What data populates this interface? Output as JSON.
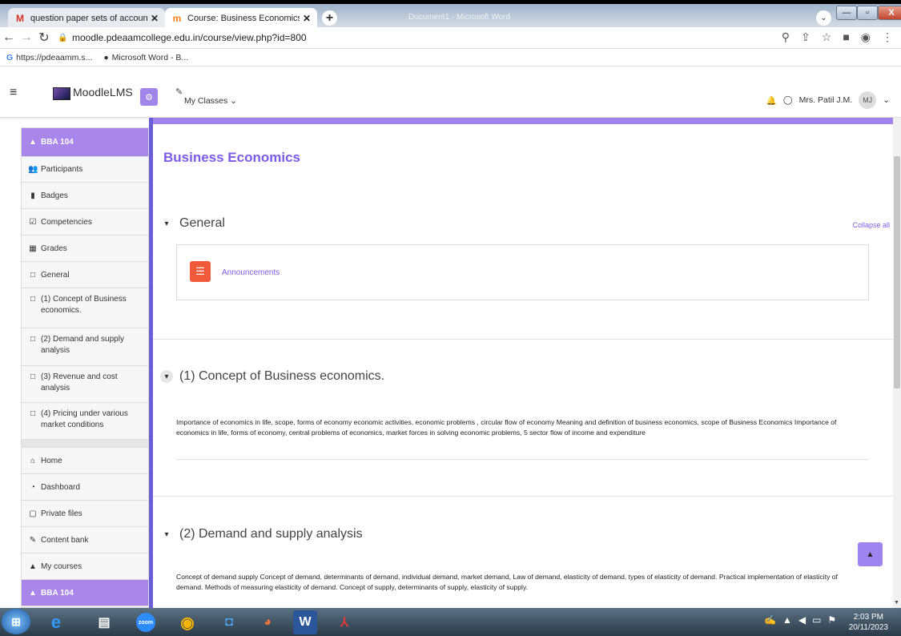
{
  "browser": {
    "tabs": [
      {
        "title": "question paper sets of accountin",
        "icon": "gmail-icon"
      },
      {
        "title": "Course: Business Economics",
        "icon": "moodle-icon"
      }
    ],
    "background_window_title": "Document1 - Microsoft Word",
    "url": "moodle.pdeaamcollege.edu.in/course/view.php?id=800",
    "bookmarks": [
      "https://pdeaamm.s...",
      "Microsoft Word - B..."
    ]
  },
  "navbar": {
    "brand": "MoodleLMS",
    "my_classes": "My Classes ⌄",
    "user_name": "Mrs. Patil J.M.",
    "avatar_initials": "MJ"
  },
  "sidebar": {
    "course": "BBA 104",
    "items": [
      {
        "label": "Participants",
        "icon": "👥"
      },
      {
        "label": "Badges",
        "icon": "▮"
      },
      {
        "label": "Competencies",
        "icon": "☑"
      },
      {
        "label": "Grades",
        "icon": "▦"
      },
      {
        "label": "General",
        "icon": "□"
      },
      {
        "label": "(1) Concept of Business economics.",
        "icon": "□"
      },
      {
        "label": "(2) Demand and supply analysis",
        "icon": "□"
      },
      {
        "label": "(3) Revenue and cost analysis",
        "icon": "□"
      },
      {
        "label": "(4) Pricing under various market conditions",
        "icon": "□"
      }
    ],
    "bottom_items": [
      {
        "label": "Home",
        "icon": "⌂"
      },
      {
        "label": "Dashboard",
        "icon": "◔"
      },
      {
        "label": "Private files",
        "icon": "▢"
      },
      {
        "label": "Content bank",
        "icon": "✎"
      },
      {
        "label": "My courses",
        "icon": "▲"
      },
      {
        "label": "BBA 104",
        "icon": "▲"
      }
    ]
  },
  "main": {
    "course_title": "Business Economics",
    "collapse_all": "Collapse all",
    "sections": [
      {
        "title": "General"
      },
      {
        "title": "(1) Concept of Business economics.",
        "summary": "Importance of economics in life, scope, forms of economy economic activities, economic problems , circular flow of economy Meaning and definition of business economics, scope of Business Economics Importance of economics in life, forms of economy, central problems of economics, market forces in solving economic problems, 5 sector flow of income and expenditure"
      },
      {
        "title": "(2) Demand and supply analysis",
        "summary": "Concept of demand supply Concept of demand, determinants of demand, individual demand, market demand, Law of demand, elasticity of demand, types of elasticity of demand. Practical implementation of elasticity of demand. Methods of measuring elasticity of demand. Concept of supply, determinants of supply, elasticity of supply."
      }
    ],
    "announcements": "Announcements"
  },
  "taskbar": {
    "zoom_label": "zoom",
    "time": "2:03 PM",
    "date": "20/11/2023"
  }
}
